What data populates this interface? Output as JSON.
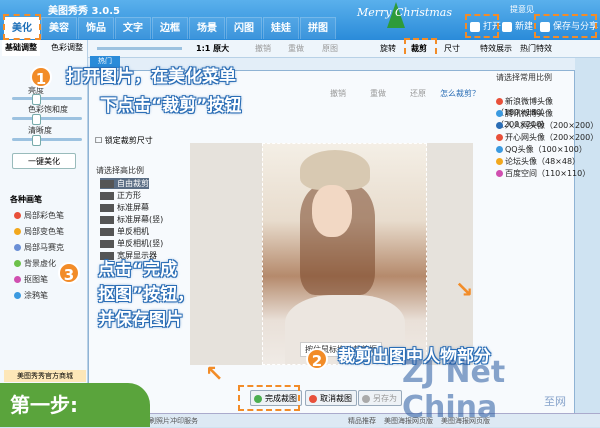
{
  "app": {
    "title": "美图秀秀 3.0.5",
    "greeting": "Merry Christmas",
    "feedback": "提意见"
  },
  "menu": [
    "美化",
    "美容",
    "饰品",
    "文字",
    "边框",
    "场景",
    "闪图",
    "娃娃",
    "拼图"
  ],
  "top_buttons": {
    "open": "打开",
    "new": "新建",
    "save": "保存与分享"
  },
  "toolbar": {
    "original": "1:1 原大",
    "undo": "撤销",
    "redo": "重做",
    "restore": "原图",
    "rotate": "旋转",
    "crop": "裁剪",
    "size": "尺寸",
    "feature": "特效展示",
    "hot": "热门特效"
  },
  "left_panel": {
    "tabs": [
      "基础调整",
      "色彩调整"
    ],
    "sliders": [
      "亮度",
      "色彩饱和度",
      "清晰度"
    ],
    "onekey": "一键美化",
    "brush_title": "各种画笔",
    "brushes": [
      {
        "label": "局部彩色笔",
        "color": "#e8503a"
      },
      {
        "label": "局部变色笔",
        "color": "#f2a81d"
      },
      {
        "label": "局部马赛克",
        "color": "#6a8fd6"
      },
      {
        "label": "背景虚化",
        "color": "#6cc14a"
      },
      {
        "label": "抠图笔",
        "color": "#d04fb0"
      },
      {
        "label": "涂鸦笔",
        "color": "#3b9ae0"
      }
    ],
    "ad": "美图秀秀官方商城"
  },
  "dialog": {
    "header_buttons": [
      "撤销",
      "重做",
      "还原"
    ],
    "help": "怎么裁剪？",
    "lock": "锁定裁剪尺寸",
    "ratio_title": "请选择高比例",
    "ratios": [
      "自由裁剪",
      "正方形",
      "标准屏幕",
      "标准屏幕(竖)",
      "单反相机",
      "单反相机(竖)",
      "宽屏显示器"
    ],
    "right_title": "请选择常用比例",
    "right_items": [
      {
        "label": "新浪微博头像（180×180）",
        "color": "#e8503a"
      },
      {
        "label": "腾讯微博头像（200×200）",
        "color": "#3b9ae0"
      },
      {
        "label": "人人网头像（200×200）",
        "color": "#2a6db5"
      },
      {
        "label": "开心网头像（200×200）",
        "color": "#e8503a"
      },
      {
        "label": "QQ头像（100×100）",
        "color": "#3b9ae0"
      },
      {
        "label": "论坛头像（48×48）",
        "color": "#f2a81d"
      },
      {
        "label": "百度空间（110×110）",
        "color": "#d04fb0"
      }
    ],
    "hint": "按住鼠标拖动裁剪框",
    "buttons": {
      "done": "完成裁图",
      "cancel": "取消裁图",
      "save_as": "另存为"
    },
    "hot_label": "热门"
  },
  "annotations": {
    "a1_line1": "打开图片，在美化菜单",
    "a1_line2": "下点击“裁剪”按钮",
    "a2": "裁剪出图中人物部分",
    "a3_line1": "点击“完成",
    "a3_line2": "抠图”按钮，",
    "a3_line3": "并保存图片",
    "n1": "1",
    "n2": "2",
    "n3": "3",
    "step": "第一步:"
  },
  "watermark": {
    "main": "ZJ Net China",
    "sub": "至网"
  },
  "status": {
    "text": "美图印刷照片冲印服务",
    "hot_rec": "精品推荐",
    "r1": "美图海报网页版",
    "r2": "美图海报网页版"
  }
}
